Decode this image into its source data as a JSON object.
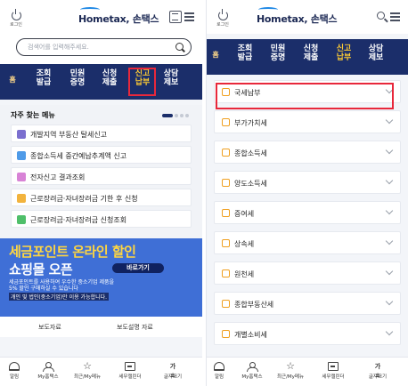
{
  "header": {
    "login_label": "로그인",
    "logo_text": "Hometax, 손택스",
    "logo_mark": "Home"
  },
  "search": {
    "placeholder": "검색어를 입력해주세요."
  },
  "nav": {
    "home": "홈",
    "items": [
      {
        "label": "조회\n발급"
      },
      {
        "label": "민원\n증명"
      },
      {
        "label": "신청\n제출"
      },
      {
        "label": "신고\n납부",
        "active": true
      },
      {
        "label": "상담\n제보"
      }
    ]
  },
  "faq": {
    "title": "자주 찾는 메뉴",
    "items": [
      {
        "label": "개발지역 부동산 탈세신고",
        "icon": "document-icon",
        "color": "#7b6fcf"
      },
      {
        "label": "종합소득세 중간예납추계액 신고",
        "icon": "report-icon",
        "color": "#4f9be8"
      },
      {
        "label": "전자신고 결과조회",
        "icon": "result-icon",
        "color": "#d883d6"
      },
      {
        "label": "근로장려금·자녀장려금 기한 후 신청",
        "icon": "apply-icon",
        "color": "#f2b33d"
      },
      {
        "label": "근로장려금·자녀장려금 신청조회",
        "icon": "inquiry-icon",
        "color": "#4fbf6a"
      }
    ]
  },
  "banner": {
    "line1": "세금포인트 온라인 할인",
    "line2": "쇼핑몰 오픈",
    "button": "바로가기",
    "desc1": "세금포인트를 사용하여 우수한 중소기업 제품을",
    "desc2": "5% 할인 구매하실 수 있습니다",
    "desc3": "개인 및 법인(중소기업)만 이용 가능합니다."
  },
  "press": {
    "left": "보도자료",
    "right": "보도설명 자료"
  },
  "tabbar": [
    {
      "label": "알림",
      "icon": "bell-icon"
    },
    {
      "label": "My홈택스",
      "icon": "user-icon"
    },
    {
      "label": "최근/My메뉴",
      "icon": "star-icon"
    },
    {
      "label": "세무캘린더",
      "icon": "calendar-icon"
    },
    {
      "label": "글자크기",
      "icon": "text-size-icon",
      "glyph": "가±"
    }
  ],
  "tax_menu": [
    {
      "label": "국세납부",
      "highlighted": true
    },
    {
      "label": "부가가치세"
    },
    {
      "label": "종합소득세"
    },
    {
      "label": "양도소득세"
    },
    {
      "label": "증여세"
    },
    {
      "label": "상속세"
    },
    {
      "label": "원천세"
    },
    {
      "label": "종합부동산세"
    },
    {
      "label": "개별소비세"
    }
  ]
}
